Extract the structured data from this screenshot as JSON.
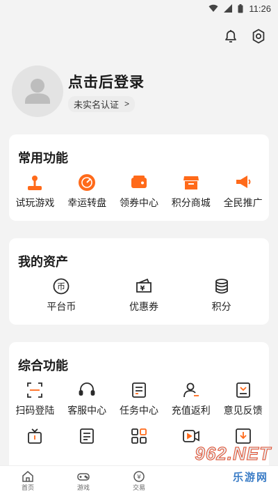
{
  "statusbar": {
    "time": "11:26"
  },
  "profile": {
    "login_text": "点击后登录",
    "realname_text": "未实名认证",
    "realname_arrow": ">"
  },
  "common": {
    "title": "常用功能",
    "items": [
      {
        "label": "试玩游戏",
        "icon": "joystick-icon"
      },
      {
        "label": "幸运转盘",
        "icon": "wheel-icon"
      },
      {
        "label": "领券中心",
        "icon": "coupon-icon"
      },
      {
        "label": "积分商城",
        "icon": "store-icon"
      },
      {
        "label": "全民推广",
        "icon": "megaphone-icon"
      }
    ]
  },
  "assets": {
    "title": "我的资产",
    "items": [
      {
        "label": "平台币",
        "icon": "coin-icon",
        "glyph": "币"
      },
      {
        "label": "优惠券",
        "icon": "voucher-icon",
        "glyph": "¥"
      },
      {
        "label": "积分",
        "icon": "points-icon"
      }
    ]
  },
  "comprehensive": {
    "title": "综合功能",
    "row1": [
      {
        "label": "扫码登陆",
        "icon": "scan-icon"
      },
      {
        "label": "客服中心",
        "icon": "headset-icon"
      },
      {
        "label": "任务中心",
        "icon": "task-icon"
      },
      {
        "label": "充值返利",
        "icon": "user-rebate-icon"
      },
      {
        "label": "意见反馈",
        "icon": "feedback-icon"
      }
    ],
    "row2": [
      {
        "icon": "gift-icon"
      },
      {
        "icon": "document-icon"
      },
      {
        "icon": "grid-icon"
      },
      {
        "icon": "video-icon"
      },
      {
        "icon": "download-icon"
      }
    ]
  },
  "nav": {
    "items": [
      {
        "label": "首页",
        "icon": "home-icon"
      },
      {
        "label": "游戏",
        "icon": "gamepad-icon"
      },
      {
        "label": "交易",
        "icon": "yen-icon",
        "glyph": "¥"
      }
    ]
  },
  "watermark": {
    "main": "962.NET",
    "sub": "乐游网"
  },
  "colors": {
    "accent": "#ff6a1a",
    "dark": "#2a2a2a",
    "card": "#ffffff",
    "background": "#f3f3f3"
  }
}
